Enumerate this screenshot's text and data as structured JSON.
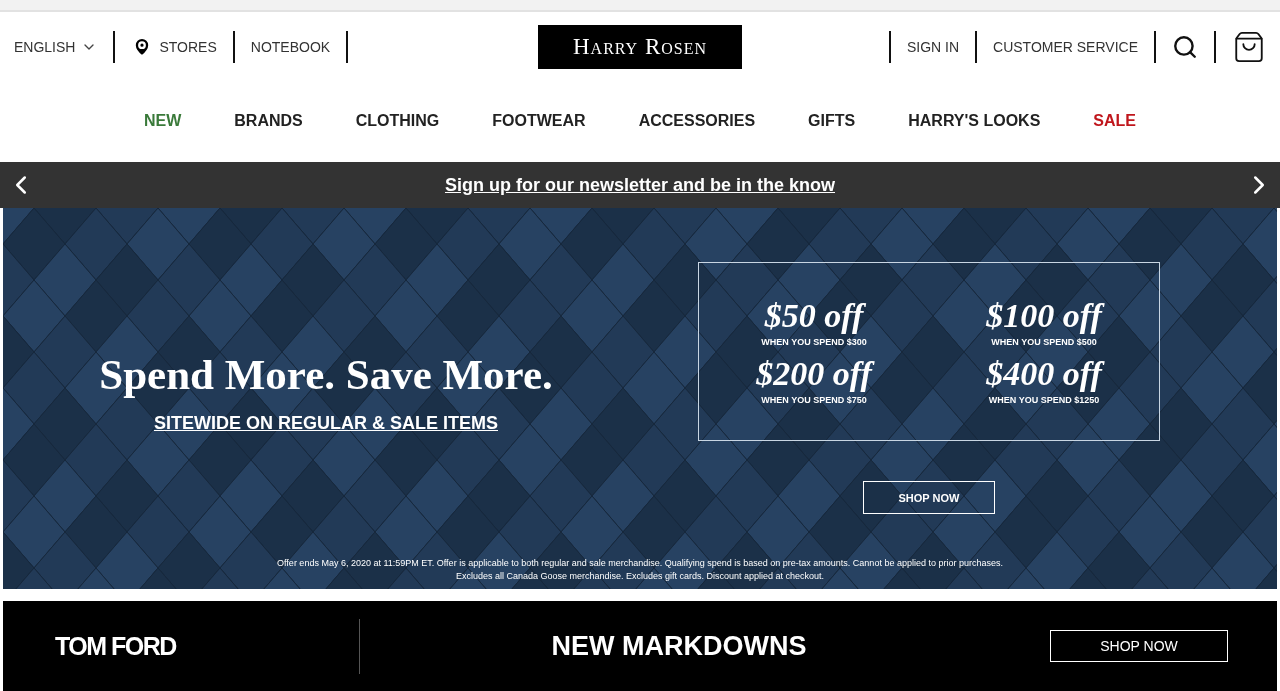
{
  "utility_left": [
    {
      "label": "ENGLISH",
      "kind": "dropdown"
    },
    {
      "label": "STORES",
      "kind": "pin"
    },
    {
      "label": "NOTEBOOK",
      "kind": "plain"
    }
  ],
  "logo": "Harry Rosen",
  "utility_right": [
    "SIGN IN",
    "CUSTOMER SERVICE"
  ],
  "nav": [
    {
      "label": "NEW",
      "color": "#3a7a3a"
    },
    {
      "label": "BRANDS",
      "color": "#222222"
    },
    {
      "label": "CLOTHING",
      "color": "#222222"
    },
    {
      "label": "FOOTWEAR",
      "color": "#222222"
    },
    {
      "label": "ACCESSORIES",
      "color": "#222222"
    },
    {
      "label": "GIFTS",
      "color": "#222222"
    },
    {
      "label": "HARRY'S LOOKS",
      "color": "#222222"
    },
    {
      "label": "SALE",
      "color": "#c0161c"
    }
  ],
  "announcement": "Sign up for our newsletter and be in the know",
  "hero": {
    "headline": "Spend More. Save More.",
    "subheadline": "SITEWIDE ON REGULAR & SALE ITEMS",
    "offers": [
      {
        "amount": "$50 off",
        "condition": "WHEN YOU SPEND $300"
      },
      {
        "amount": "$100 off",
        "condition": "WHEN YOU SPEND $500"
      },
      {
        "amount": "$200 off",
        "condition": "WHEN YOU SPEND $750"
      },
      {
        "amount": "$400 off",
        "condition": "WHEN YOU SPEND $1250"
      }
    ],
    "button": "SHOP NOW",
    "disclaimer": [
      "Offer ends May 6, 2020 at 11:59PM ET. Offer is applicable to both regular and sale merchandise. Qualifying spend is based on pre-tax amounts. Cannot be applied to prior purchases.",
      "Excludes all Canada Goose merchandise. Excludes gift cards. Discount applied at checkout."
    ]
  },
  "promo": {
    "brand": "TOM FORD",
    "title": "NEW MARKDOWNS",
    "button": "SHOP NOW"
  }
}
